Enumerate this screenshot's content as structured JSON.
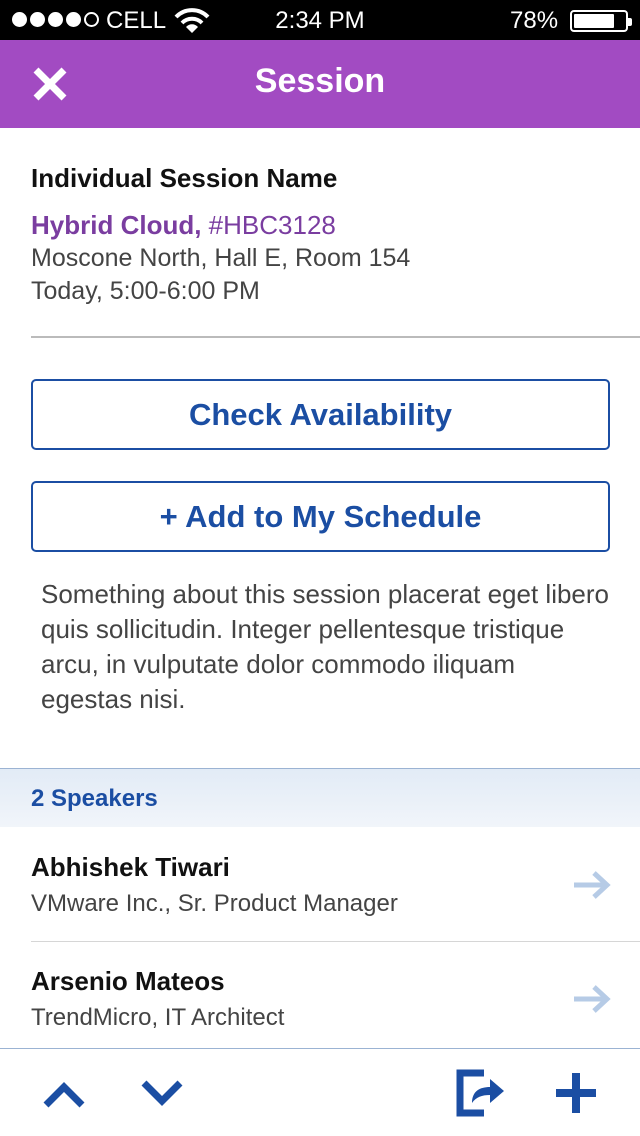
{
  "status_bar": {
    "carrier": "CELL",
    "time": "2:34 PM",
    "battery": "78%",
    "signal_bars": 4,
    "signal_total": 5,
    "battery_level": 0.78
  },
  "header": {
    "title": "Session",
    "close_icon": "close-icon",
    "background": "#a24bc2"
  },
  "session": {
    "heading": "Individual Session Name",
    "title": "Hybrid Cloud,",
    "code": "#HBC3128",
    "location": "Moscone North, Hall E, Room 154",
    "time": "Today, 5:00-6:00 PM"
  },
  "actions": {
    "check_availability": "Check Availability",
    "add_schedule": "+ Add to My Schedule"
  },
  "description": "Something about this session placerat eget libero quis sollicitudin. Integer pellentesque tristique arcu, in vulputate dolor commodo iliquam egestas nisi.",
  "speakers": {
    "header": "2 Speakers",
    "items": [
      {
        "name": "Abhishek Tiwari",
        "role": "VMware Inc., Sr. Product Manager"
      },
      {
        "name": "Arsenio Mateos",
        "role": "TrendMicro, IT Architect"
      }
    ]
  },
  "toolbar": {
    "icons": [
      "chevron-up-icon",
      "chevron-down-icon",
      "share-icon",
      "plus-icon"
    ]
  },
  "colors": {
    "accent": "#1b4ea3",
    "purple": "#a24bc2",
    "purple_text": "#7a3da0",
    "arrow": "#b6cbe6"
  }
}
